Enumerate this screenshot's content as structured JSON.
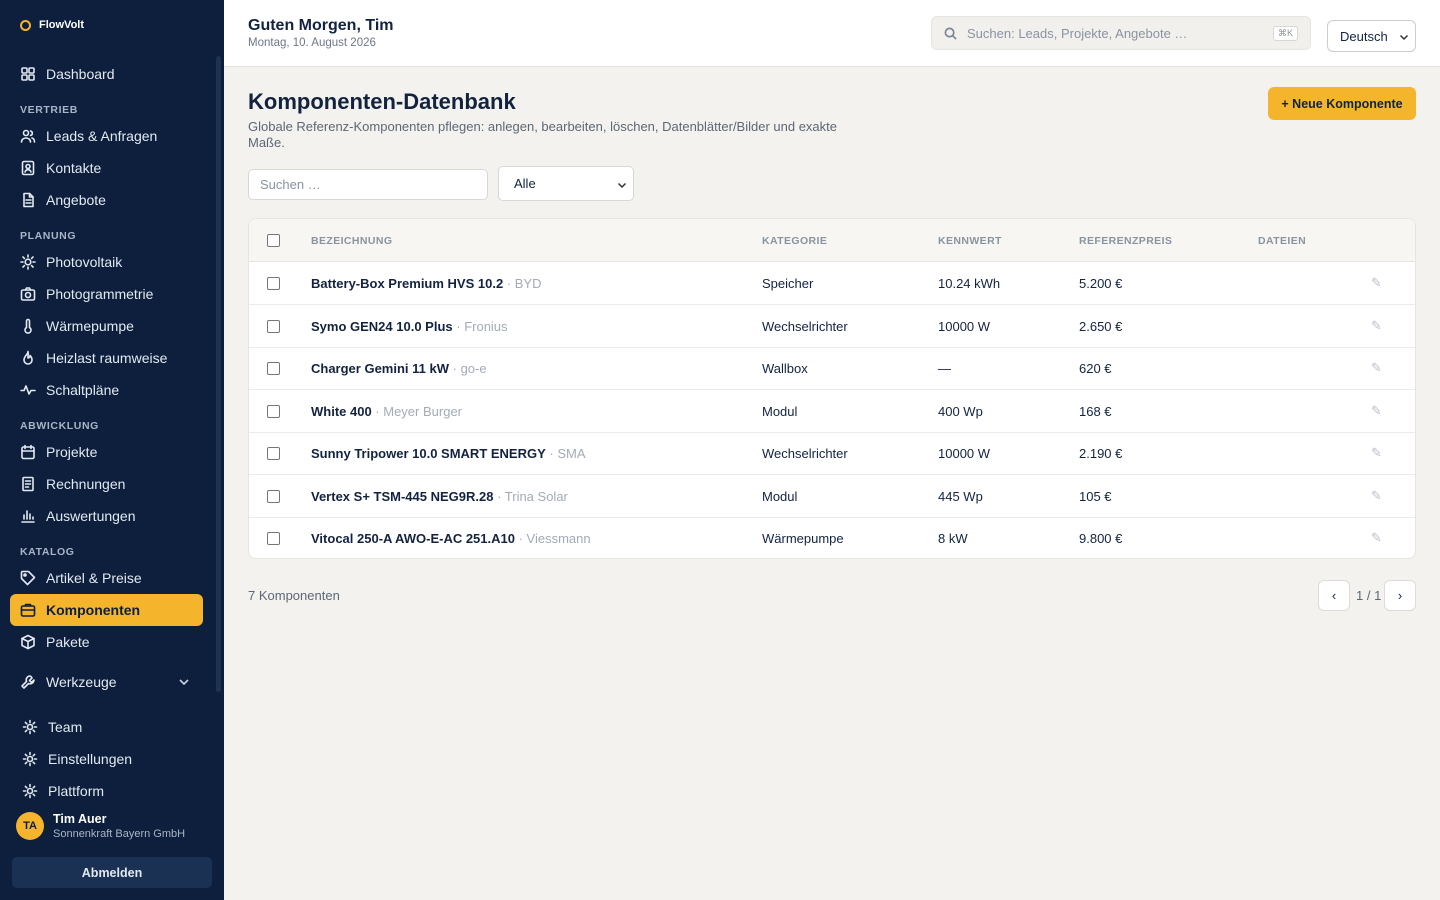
{
  "app": {
    "name": "FlowVolt"
  },
  "sidebar": {
    "dashboard": "Dashboard",
    "sections": {
      "vertrieb": "VERTRIEB",
      "planung": "PLANUNG",
      "abwicklung": "ABWICKLUNG",
      "katalog": "KATALOG"
    },
    "items": {
      "leads": "Leads & Anfragen",
      "kontakte": "Kontakte",
      "angebote": "Angebote",
      "photovoltaik": "Photovoltaik",
      "photogrammetrie": "Photogrammetrie",
      "waermepumpe": "Wärmepumpe",
      "heizlast": "Heizlast raumweise",
      "schaltplaene": "Schaltpläne",
      "projekte": "Projekte",
      "rechnungen": "Rechnungen",
      "auswertungen": "Auswertungen",
      "artikel": "Artikel & Preise",
      "komponenten": "Komponenten",
      "pakete": "Pakete",
      "werkzeuge": "Werkzeuge",
      "team": "Team",
      "einstellungen": "Einstellungen",
      "plattform": "Plattform"
    },
    "active": "komponenten",
    "user": {
      "initials": "TA",
      "name": "Tim Auer",
      "company": "Sonnenkraft Bayern GmbH"
    },
    "logout_label": "Abmelden"
  },
  "header": {
    "greeting": "Guten Morgen, Tim",
    "date": "Montag, 10. August 2026",
    "search_placeholder": "Suchen: Leads, Projekte, Angebote …",
    "search_shortcut": "⌘K",
    "language": "Deutsch"
  },
  "page": {
    "title": "Komponenten-Datenbank",
    "subtitle": "Globale Referenz-Komponenten pflegen: anlegen, bearbeiten, löschen, Datenblätter/Bilder und exakte Maße.",
    "new_button": "+ Neue Komponente",
    "search_placeholder": "Suchen …",
    "filter_value": "Alle"
  },
  "table": {
    "columns": [
      "BEZEICHNUNG",
      "KATEGORIE",
      "KENNWERT",
      "REFERENZPREIS",
      "DATEIEN"
    ],
    "rows": [
      {
        "name": "Battery-Box Premium HVS 10.2",
        "manufacturer": "BYD",
        "category": "Speicher",
        "value": "10.24 kWh",
        "price": "5.200 €"
      },
      {
        "name": "Symo GEN24 10.0 Plus",
        "manufacturer": "Fronius",
        "category": "Wechselrichter",
        "value": "10000 W",
        "price": "2.650 €"
      },
      {
        "name": "Charger Gemini 11 kW",
        "manufacturer": "go-e",
        "category": "Wallbox",
        "value": "—",
        "price": "620 €"
      },
      {
        "name": "White 400",
        "manufacturer": "Meyer Burger",
        "category": "Modul",
        "value": "400 Wp",
        "price": "168 €"
      },
      {
        "name": "Sunny Tripower 10.0 SMART ENERGY",
        "manufacturer": "SMA",
        "category": "Wechselrichter",
        "value": "10000 W",
        "price": "2.190 €"
      },
      {
        "name": "Vertex S+ TSM-445 NEG9R.28",
        "manufacturer": "Trina Solar",
        "category": "Modul",
        "value": "445 Wp",
        "price": "105 €"
      },
      {
        "name": "Vitocal 250-A AWO-E-AC 251.A10",
        "manufacturer": "Viessmann",
        "category": "Wärmepumpe",
        "value": "8 kW",
        "price": "9.800 €"
      }
    ],
    "separator": "·",
    "edit_icon": "✎"
  },
  "footer": {
    "count": "7 Komponenten",
    "prev": "‹",
    "next": "›",
    "page_indicator": "1 / 1"
  },
  "colors": {
    "sidebar_bg": "#0d1f3c",
    "accent": "#f4b52c",
    "page_bg": "#f3f2ee"
  }
}
